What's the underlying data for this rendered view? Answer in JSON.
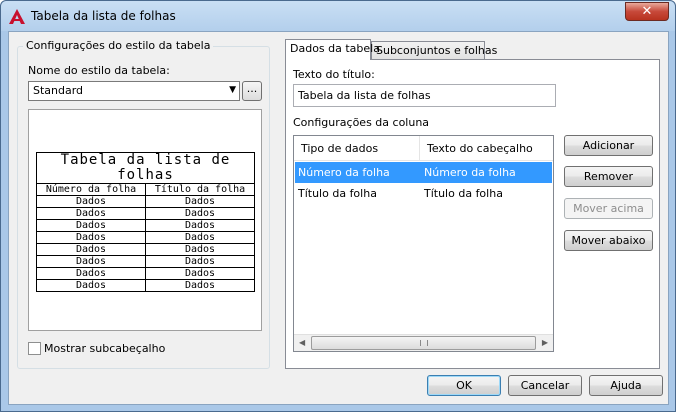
{
  "window": {
    "title": "Tabela da lista de folhas",
    "close_label": "✕"
  },
  "style_group": {
    "title": "Configurações do estilo da tabela",
    "style_name_label": "Nome do estilo da tabela:",
    "style_name_value": "Standard",
    "browse_label": "...",
    "preview": {
      "title": "Tabela da lista de folhas",
      "headers": [
        "Número da folha",
        "Título da folha"
      ],
      "cell": "Dados"
    },
    "show_subheader_label": "Mostrar subcabeçalho",
    "show_subheader_checked": false
  },
  "tabs": [
    {
      "label": "Dados da tabela",
      "active": true
    },
    {
      "label": "Subconjuntos e folhas",
      "active": false
    }
  ],
  "table_data": {
    "title_text_label": "Texto do título:",
    "title_text_value": "Tabela da lista de folhas",
    "column_settings_label": "Configurações da coluna",
    "columns_headers": [
      "Tipo de dados",
      "Texto do cabeçalho"
    ],
    "rows": [
      {
        "data_type": "Número da folha",
        "header_text": "Número da folha",
        "selected": true
      },
      {
        "data_type": "Título da folha",
        "header_text": "Título da folha",
        "selected": false
      }
    ],
    "buttons": {
      "add": "Adicionar",
      "remove": "Remover",
      "move_up": "Mover acima",
      "move_down": "Mover abaixo"
    }
  },
  "footer": {
    "ok": "OK",
    "cancel": "Cancelar",
    "help": "Ajuda"
  },
  "colors": {
    "selection": "#3399ff",
    "app_icon": "#c8102e"
  }
}
